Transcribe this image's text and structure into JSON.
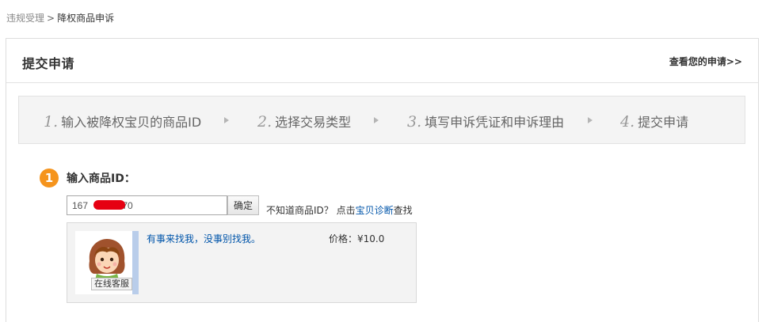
{
  "breadcrumb": {
    "parent": "违规受理",
    "separator": ">",
    "current": "降权商品申诉"
  },
  "header": {
    "title": "提交申请",
    "view_link": "查看您的申请>>"
  },
  "steps": [
    {
      "num": "1.",
      "label": "输入被降权宝贝的商品ID"
    },
    {
      "num": "2.",
      "label": "选择交易类型"
    },
    {
      "num": "3.",
      "label": "填写申诉凭证和申诉理由"
    },
    {
      "num": "4.",
      "label": "提交申请"
    }
  ],
  "section": {
    "badge": "1",
    "label": "输入商品ID："
  },
  "form": {
    "input_value": "167           370",
    "confirm_label": "确定",
    "hint_text": "不知道商品ID？ 点击",
    "hint_link": "宝贝诊断",
    "hint_suffix": "查找"
  },
  "result": {
    "avatar_label": "在线客服",
    "item_title": "有事来找我，没事别找我。",
    "price_label": "价格：",
    "price_value": "¥10.0"
  },
  "colors": {
    "badge": "#f5941d",
    "link": "#0055aa",
    "redaction": "#e60012",
    "avatar_bar": "#b9cdea"
  }
}
